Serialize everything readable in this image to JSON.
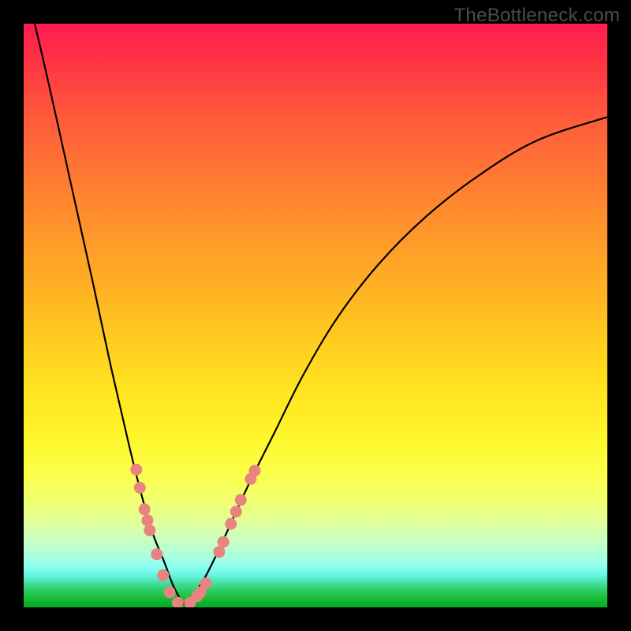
{
  "watermark": "TheBottleneck.com",
  "colors": {
    "background": "#000000",
    "curve_stroke": "#000000",
    "dot_fill": "#e98380",
    "gradient_top": "#ff1b4f",
    "gradient_bottom": "#05ad26"
  },
  "chart_data": {
    "type": "line",
    "title": "",
    "xlabel": "",
    "ylabel": "",
    "xlim": [
      0,
      100
    ],
    "ylim": [
      0,
      100
    ],
    "axes_visible": false,
    "series": [
      {
        "name": "bottleneck-curve-left",
        "x": [
          0,
          4,
          8,
          12,
          15,
          18,
          20,
          22,
          24,
          25.5,
          26.5,
          27.5
        ],
        "y": [
          108,
          91,
          73,
          55,
          41,
          28,
          20,
          13,
          8,
          4,
          2,
          0.5
        ]
      },
      {
        "name": "bottleneck-curve-right",
        "x": [
          27.5,
          29,
          31,
          33.5,
          36,
          39,
          43,
          48,
          54,
          61,
          69,
          78,
          88,
          100
        ],
        "y": [
          0.5,
          2,
          5,
          10,
          15.5,
          22,
          30,
          40,
          50,
          59,
          67,
          74,
          80,
          84
        ]
      }
    ],
    "annotations": {
      "dots": [
        {
          "x": 19.3,
          "y": 23.6
        },
        {
          "x": 19.9,
          "y": 20.5
        },
        {
          "x": 20.7,
          "y": 16.8
        },
        {
          "x": 21.2,
          "y": 14.9
        },
        {
          "x": 21.6,
          "y": 13.2
        },
        {
          "x": 22.8,
          "y": 9.1
        },
        {
          "x": 23.9,
          "y": 5.5
        },
        {
          "x": 25.0,
          "y": 2.6
        },
        {
          "x": 26.4,
          "y": 0.8
        },
        {
          "x": 28.5,
          "y": 0.8
        },
        {
          "x": 29.7,
          "y": 1.9
        },
        {
          "x": 30.3,
          "y": 2.6
        },
        {
          "x": 31.2,
          "y": 4.1
        },
        {
          "x": 33.5,
          "y": 9.5
        },
        {
          "x": 34.2,
          "y": 11.2
        },
        {
          "x": 35.5,
          "y": 14.3
        },
        {
          "x": 36.4,
          "y": 16.4
        },
        {
          "x": 37.2,
          "y": 18.4
        },
        {
          "x": 38.9,
          "y": 22.0
        },
        {
          "x": 39.6,
          "y": 23.4
        }
      ]
    }
  }
}
